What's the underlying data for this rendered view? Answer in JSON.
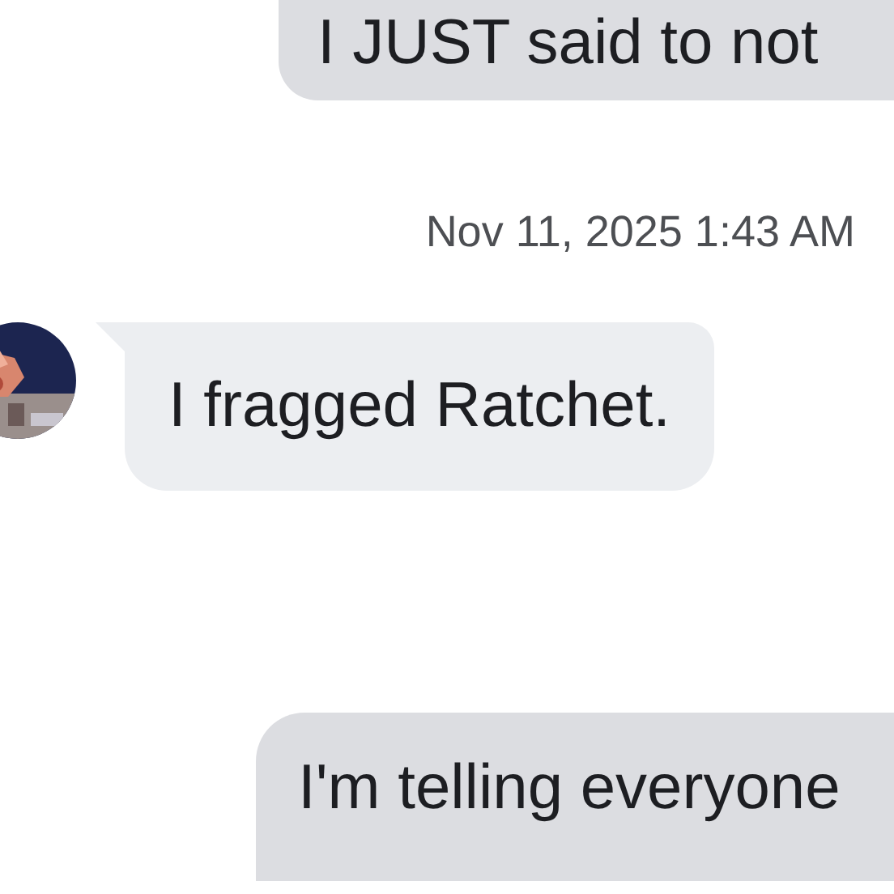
{
  "messages": [
    {
      "kind": "outgoing",
      "lines": [
        "I JUST said to not"
      ]
    },
    {
      "kind": "timestamp",
      "text": "Nov 11, 2025 1:43 AM"
    },
    {
      "kind": "incoming",
      "lines": [
        "I fragged Ratchet."
      ]
    },
    {
      "kind": "outgoing",
      "lines": [
        "I'm telling everyone"
      ]
    }
  ]
}
